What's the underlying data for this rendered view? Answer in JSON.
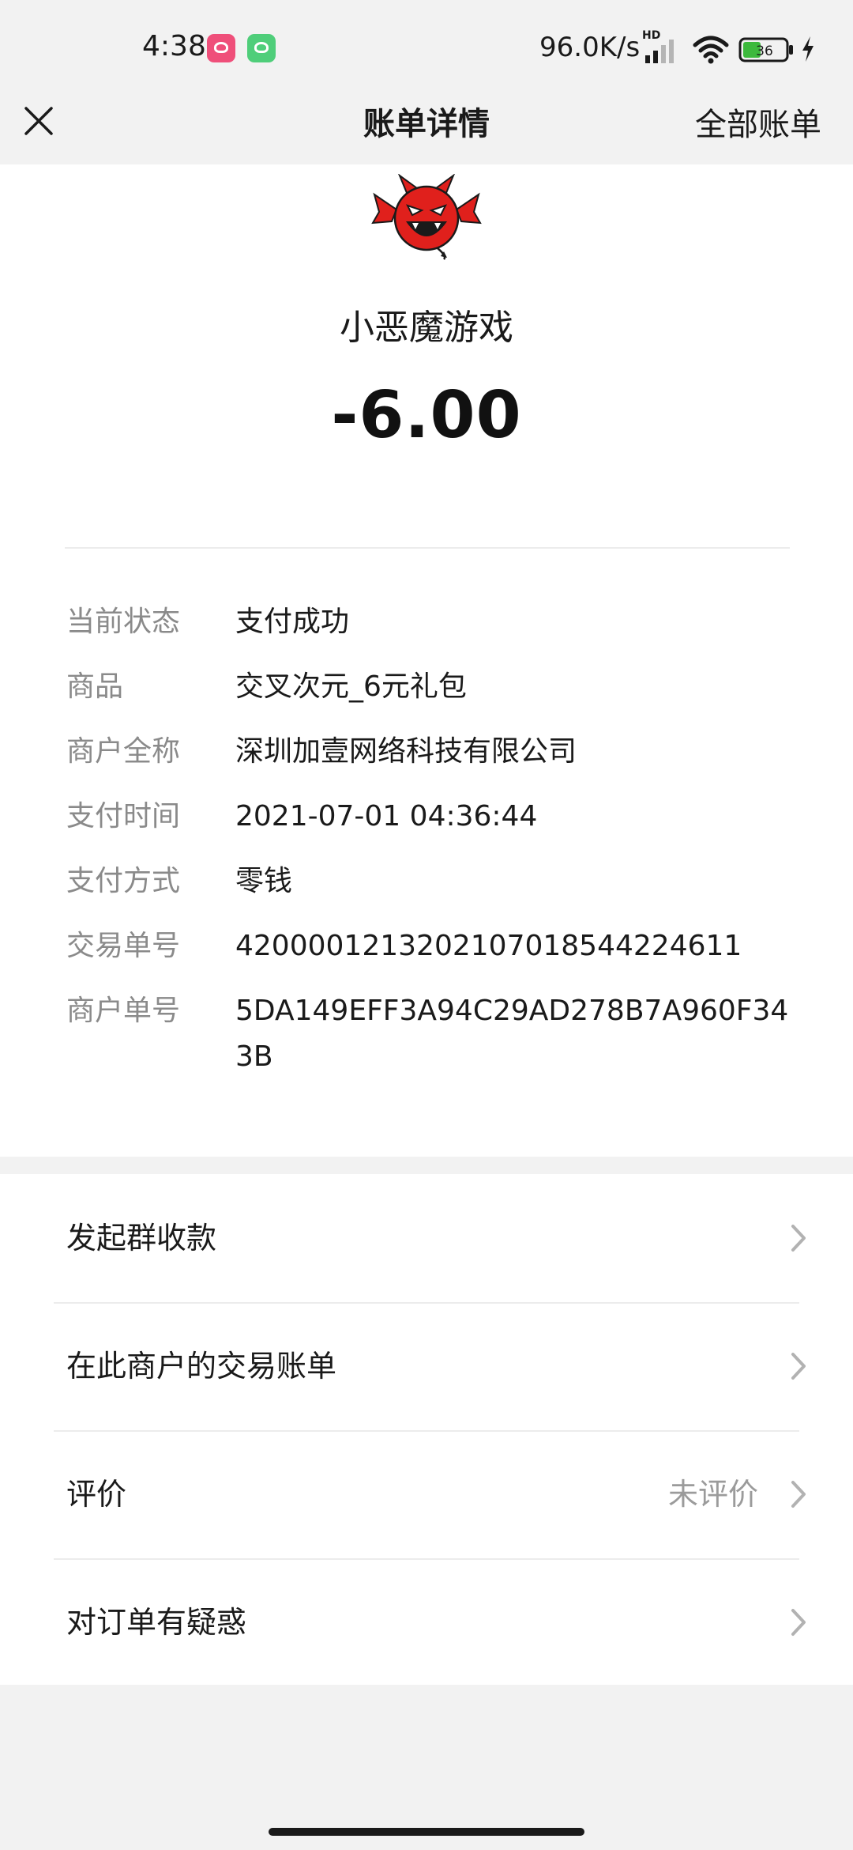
{
  "status_bar": {
    "time": "4:38",
    "net_speed": "96.0K/s",
    "network_type": "HD",
    "battery_level": "36",
    "icons": [
      "app-badge-icon",
      "android-icon",
      "signal-icon",
      "wifi-icon",
      "battery-icon",
      "charging-icon"
    ]
  },
  "nav": {
    "title": "账单详情",
    "right_label": "全部账单",
    "close_icon": "close-icon"
  },
  "merchant": {
    "logo_icon": "devil-logo-icon",
    "name": "小恶魔游戏",
    "amount": "-6.00"
  },
  "details": [
    {
      "label": "当前状态",
      "value": "支付成功"
    },
    {
      "label": "商品",
      "value": "交叉次元_6元礼包"
    },
    {
      "label": "商户全称",
      "value": "深圳加壹网络科技有限公司"
    },
    {
      "label": "支付时间",
      "value": "2021-07-01 04:36:44"
    },
    {
      "label": "支付方式",
      "value": "零钱"
    },
    {
      "label": "交易单号",
      "value": "4200001213202107018544224611"
    },
    {
      "label": "商户单号",
      "value": "5DA149EFF3A94C29AD278B7A960F343B"
    }
  ],
  "actions": [
    {
      "label": "发起群收款",
      "right": ""
    },
    {
      "label": "在此商户的交易账单",
      "right": ""
    },
    {
      "label": "评价",
      "right": "未评价"
    },
    {
      "label": "对订单有疑惑",
      "right": ""
    }
  ],
  "colors": {
    "background": "#f2f2f2",
    "card": "#ffffff",
    "label_gray": "#8a8a8a",
    "text": "#1a1a1a",
    "logo_red": "#e0201c"
  }
}
